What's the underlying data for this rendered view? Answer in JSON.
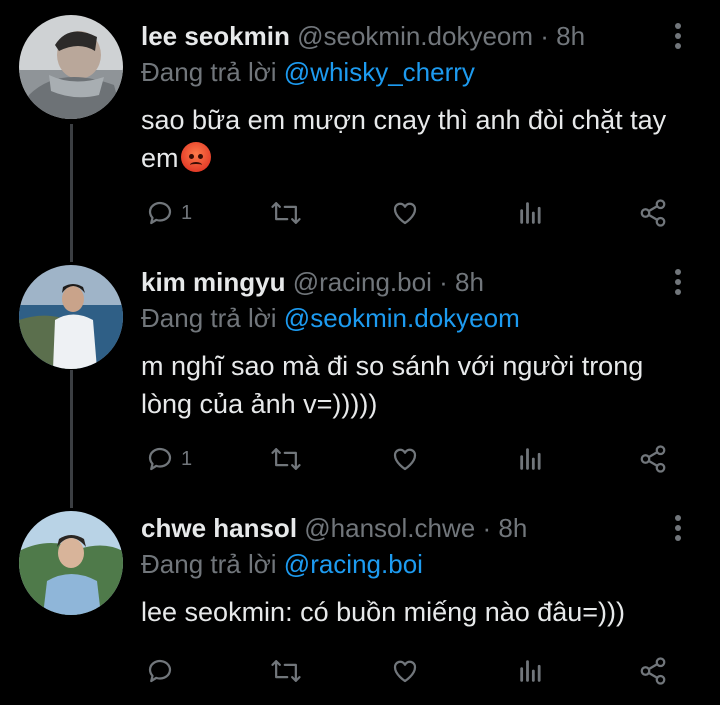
{
  "tweets": [
    {
      "name": "lee seokmin",
      "handle": "@seokmin.dokyeom",
      "separator": "·",
      "time": "8h",
      "reply_prefix": "Đang trả lời",
      "reply_to": "@whisky_cherry",
      "text": "sao bữa em mượn cnay thì anh đòi chặt tay em",
      "reply_count": "1",
      "emoji": "angry-face"
    },
    {
      "name": "kim mingyu",
      "handle": "@racing.boi",
      "separator": "·",
      "time": "8h",
      "reply_prefix": "Đang trả lời",
      "reply_to": "@seokmin.dokyeom",
      "text": "m nghĩ sao mà đi so sánh với người trong lòng của ảnh v=)))))",
      "reply_count": "1"
    },
    {
      "name": "chwe hansol",
      "handle": "@hansol.chwe",
      "separator": "·",
      "time": "8h",
      "reply_prefix": "Đang trả lời",
      "reply_to": "@racing.boi",
      "text": "lee seokmin: có buồn miếng nào đâu=)))",
      "reply_count": ""
    }
  ],
  "colors": {
    "background": "#000000",
    "name": "#e7e9ea",
    "secondary": "#71767b",
    "mention": "#1d9bf0",
    "thread_line": "#3b3e42"
  },
  "icons": [
    "reply-icon",
    "retweet-icon",
    "like-icon",
    "analytics-icon",
    "share-icon",
    "more-icon"
  ]
}
